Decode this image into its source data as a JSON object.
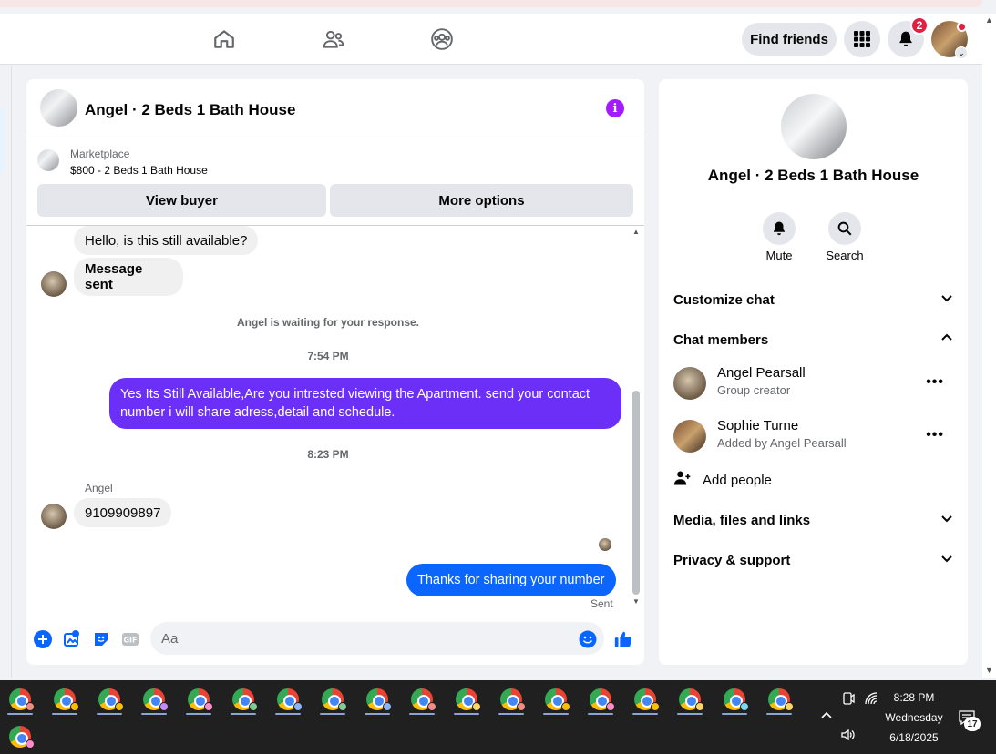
{
  "nav": {
    "find_friends": "Find friends",
    "notification_count": "2"
  },
  "chat": {
    "title": "Angel · 2 Beds 1 Bath House",
    "marketplace_label": "Marketplace",
    "marketplace_item": "$800 - 2 Beds 1 Bath House",
    "view_buyer": "View buyer",
    "more_options": "More options",
    "messages": {
      "incoming_1": "Hello, is this still available?",
      "incoming_2": "Message sent",
      "waiting": "Angel is waiting for your response.",
      "time_1": "7:54 PM",
      "outgoing_1": "Yes Its Still Available,Are you intrested viewing the Apartment. send your contact number i will share adress,detail and schedule.",
      "time_2": "8:23 PM",
      "sender_name": "Angel",
      "incoming_3": "9109909897",
      "outgoing_2": "Thanks for sharing your number",
      "status": "Sent"
    },
    "composer_placeholder": "Aa"
  },
  "side": {
    "title": "Angel · 2 Beds 1 Bath House",
    "mute": "Mute",
    "search": "Search",
    "customize_chat": "Customize chat",
    "chat_members": "Chat members",
    "members": [
      {
        "name": "Angel Pearsall",
        "subtitle": "Group creator"
      },
      {
        "name": "Sophie Turne",
        "subtitle": "Added by Angel Pearsall"
      }
    ],
    "add_people": "Add people",
    "media": "Media, files and links",
    "privacy": "Privacy & support"
  },
  "taskbar": {
    "time": "8:28 PM",
    "day": "Wednesday",
    "date": "6/18/2025",
    "notif_count": "17"
  },
  "colors": {
    "accent": "#0866ff",
    "bubble_purple": "#6b2ff8",
    "bubble_blue": "#0a66ff",
    "info_purple": "#a31aff"
  }
}
